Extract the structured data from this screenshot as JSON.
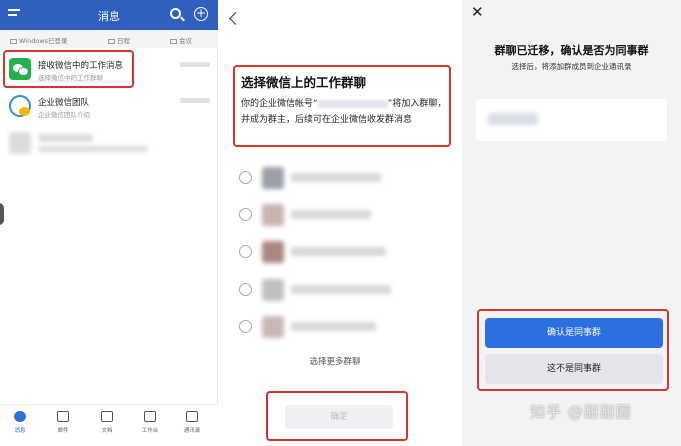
{
  "panel1": {
    "header": {
      "title": "消息"
    },
    "subbar": {
      "windows": "Windows已登录",
      "calendar": "日程",
      "meeting": "会议"
    },
    "rows": [
      {
        "name": "接收微信中的工作消息",
        "desc": "选择微信中的工作群聊"
      },
      {
        "name": "企业微信团队",
        "desc": "企业微信团队介绍"
      }
    ],
    "tabs": [
      "消息",
      "邮件",
      "文档",
      "工作台",
      "通讯录"
    ]
  },
  "panel2": {
    "heading": "选择微信上的工作群聊",
    "para_prefix": "你的企业微信帐号“",
    "para_suffix": "”将加入群聊，并成为群主，后续可在企业微信收发群消息",
    "more": "选择更多群聊",
    "confirm": "确定"
  },
  "panel3": {
    "close": "✕",
    "title": "群聊已迁移，确认是否为同事群",
    "subtitle": "选择后，将添加群成员到企业通讯录",
    "btn_confirm": "确认是同事群",
    "btn_deny": "这不是同事群"
  },
  "watermark": "知乎 @甜甜圈",
  "colors": {
    "header_blue": "#2f5fbf",
    "primary": "#2c6fe0",
    "highlight": "#d6342d",
    "wechat_green": "#22b14c"
  }
}
